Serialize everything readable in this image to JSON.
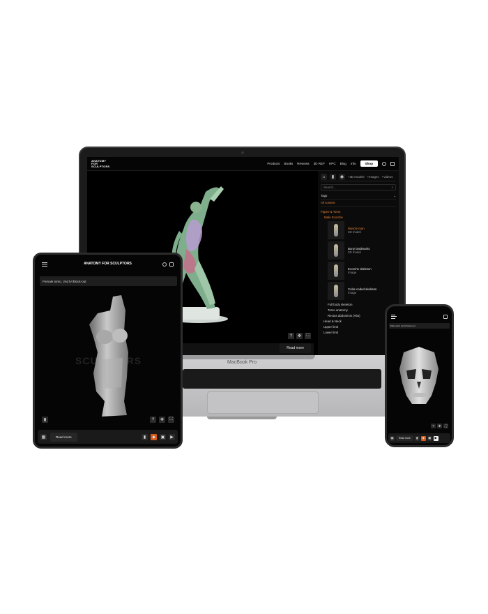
{
  "laptop": {
    "brand_label": "MacBook Pro",
    "logo": "ANATOMY FOR SCULPTORS",
    "nav_links": [
      "Products",
      "Books",
      "Reviews",
      "3D REF",
      "HPC",
      "Blog",
      "Info"
    ],
    "shop_label": "Shop",
    "sidebar": {
      "tab_filters": [
        "+3D models",
        "+Images",
        "+Videos"
      ],
      "search_placeholder": "Search...",
      "tags_label": "Tags",
      "all_content_label": "All content",
      "category": "Figure & Torso",
      "subcategory": "Male Ecorche",
      "items": [
        {
          "title": "Muscle man",
          "type": "3D model"
        },
        {
          "title": "Bony landmarks",
          "type": "3D model"
        },
        {
          "title": "Ecorche skeleton",
          "type": "Image"
        },
        {
          "title": "Color-coded skeleton",
          "type": "Image"
        }
      ],
      "sub_sections": [
        "Full body skeleton",
        "Torso anatomy",
        "Rectus abdominis (Abs)"
      ],
      "sections": [
        "Head & Neck",
        "Upper limb",
        "Lower limb"
      ]
    },
    "read_more": "Read more"
  },
  "tablet": {
    "logo": "ANATOMY FOR SCULPTORS",
    "model_title": "Female torso. 2nd lvl block-out",
    "watermark": "SCULPTORS",
    "read_more": "Read more"
  },
  "phone": {
    "model_title": "Male skull. 1st lvl block-out",
    "read_more": "Read more"
  },
  "icons": {
    "help": "?",
    "move": "✥",
    "fullscreen": "⛶",
    "pin": "📍",
    "grid": "grid-icon"
  },
  "colors": {
    "accent_orange": "#e8833a",
    "tool_accent": "#d55a1a",
    "screen_bg": "#000000"
  }
}
